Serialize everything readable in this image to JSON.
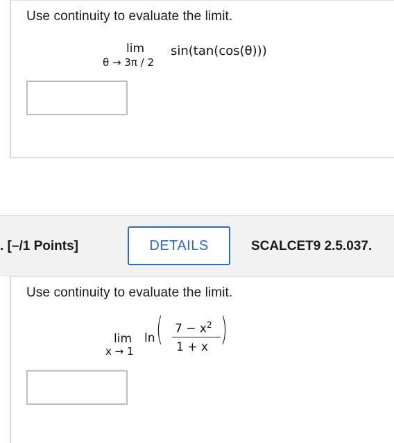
{
  "problem1": {
    "prompt": "Use continuity to evaluate the limit.",
    "lim_word": "lim",
    "lim_sub": "θ → 3π / 2",
    "expression": "sin(tan(cos(θ)))",
    "answer_value": ""
  },
  "header": {
    "points": ". [–/1 Points]",
    "details_label": "DETAILS",
    "code": "SCALCET9 2.5.037."
  },
  "problem2": {
    "prompt": "Use continuity to evaluate the limit.",
    "lim_word": "lim",
    "lim_sub": "x → 1",
    "func": "ln",
    "numerator": "7 − x",
    "numerator_exp": "2",
    "denominator": "1 + x",
    "answer_value": ""
  },
  "colors": {
    "accent": "#2a6bbf",
    "border": "#bdbdbd",
    "header_bg": "#f2f2f2"
  }
}
